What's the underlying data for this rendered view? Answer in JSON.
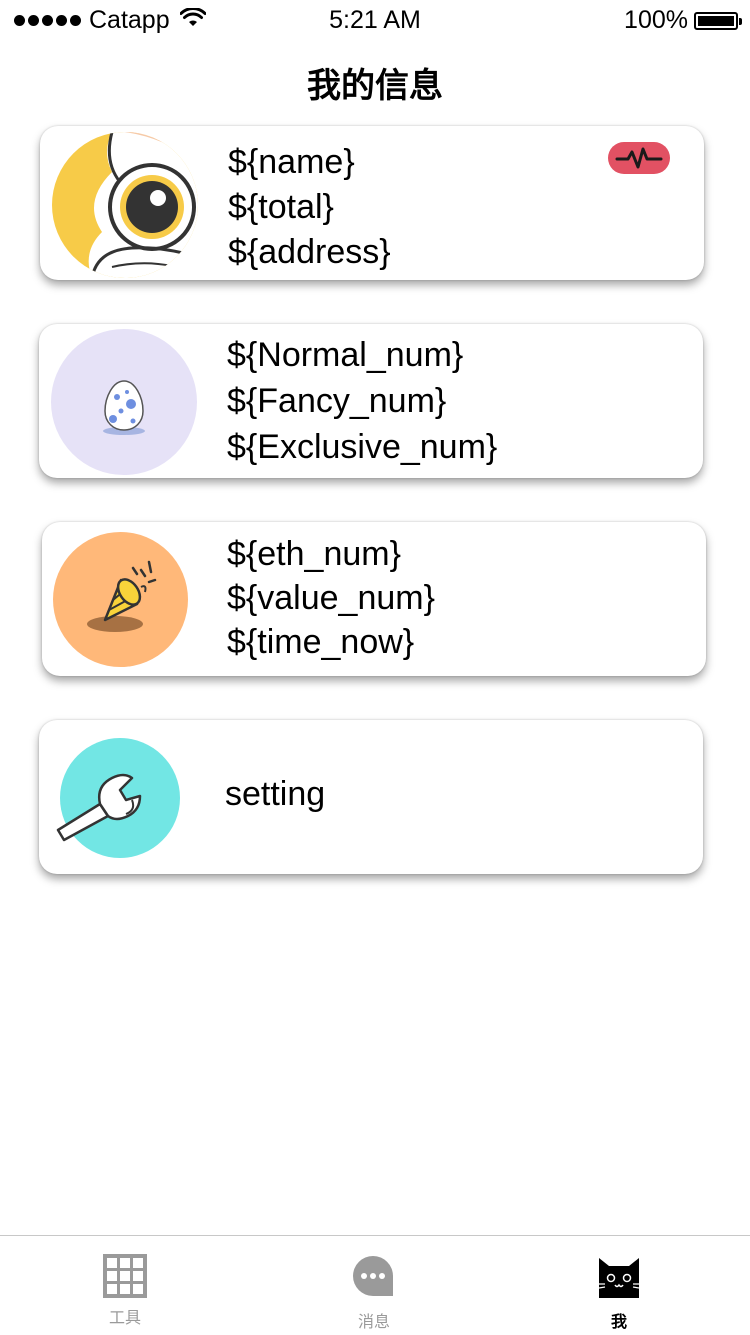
{
  "status_bar": {
    "carrier": "Catapp",
    "time": "5:21 AM",
    "battery": "100%"
  },
  "header": {
    "title": "我的信息"
  },
  "cards": [
    {
      "lines": [
        "${name}",
        "${total}",
        "${address}"
      ],
      "icon": "owl-avatar",
      "badge_icon": "pulse-icon"
    },
    {
      "lines": [
        "${Normal_num}",
        "${Fancy_num}",
        "${Exclusive_num}"
      ],
      "icon": "egg-icon"
    },
    {
      "lines": [
        "${eth_num}",
        "${value_num}",
        "${time_now}"
      ],
      "icon": "party-popper-icon"
    },
    {
      "lines": [
        "setting"
      ],
      "icon": "wrench-icon"
    }
  ],
  "tab_bar": {
    "tabs": [
      {
        "label": "工具",
        "icon": "grid-icon",
        "active": false
      },
      {
        "label": "消息",
        "icon": "chat-bubble-icon",
        "active": false
      },
      {
        "label": "我",
        "icon": "cat-icon",
        "active": true
      }
    ]
  },
  "colors": {
    "badge": "#e25163",
    "egg_bg": "#e6e2f7",
    "popper_bg": "#ffb879",
    "wrench_bg": "#72e6e4",
    "inactive_tab": "#9a9a9a"
  }
}
